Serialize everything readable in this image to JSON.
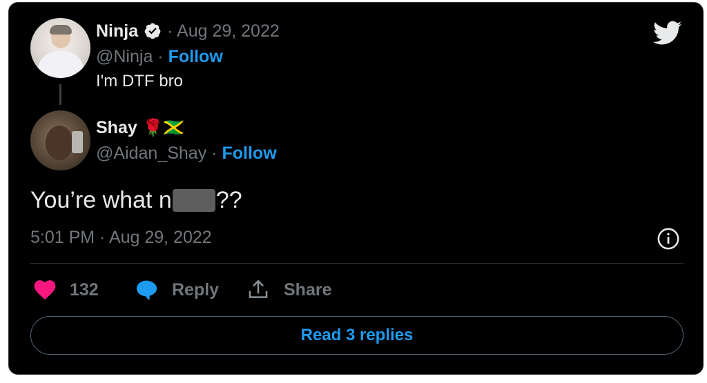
{
  "reply_to": {
    "name": "Ninja",
    "date": "· Aug 29, 2022",
    "handle": "@Ninja ·",
    "follow_label": "Follow",
    "text": "I'm DTF bro"
  },
  "tweet": {
    "name": "Shay",
    "name_emojis": "🌹🇯🇲",
    "handle": "@Aidan_Shay ·",
    "follow_label": "Follow",
    "text_before": "You’re what n",
    "text_after": "??",
    "timestamp": "5:01 PM · Aug 29, 2022"
  },
  "actions": {
    "like_count": "132",
    "reply_label": "Reply",
    "share_label": "Share"
  },
  "read_replies_label": "Read 3 replies",
  "colors": {
    "background": "#000000",
    "text": "#e7e9ea",
    "muted": "#71767b",
    "link": "#1d9bf0",
    "like": "#f91880",
    "border": "#2f3336"
  },
  "icons": [
    "verified-badge-icon",
    "twitter-logo-icon",
    "info-icon",
    "heart-icon",
    "reply-bubble-icon",
    "share-icon"
  ]
}
